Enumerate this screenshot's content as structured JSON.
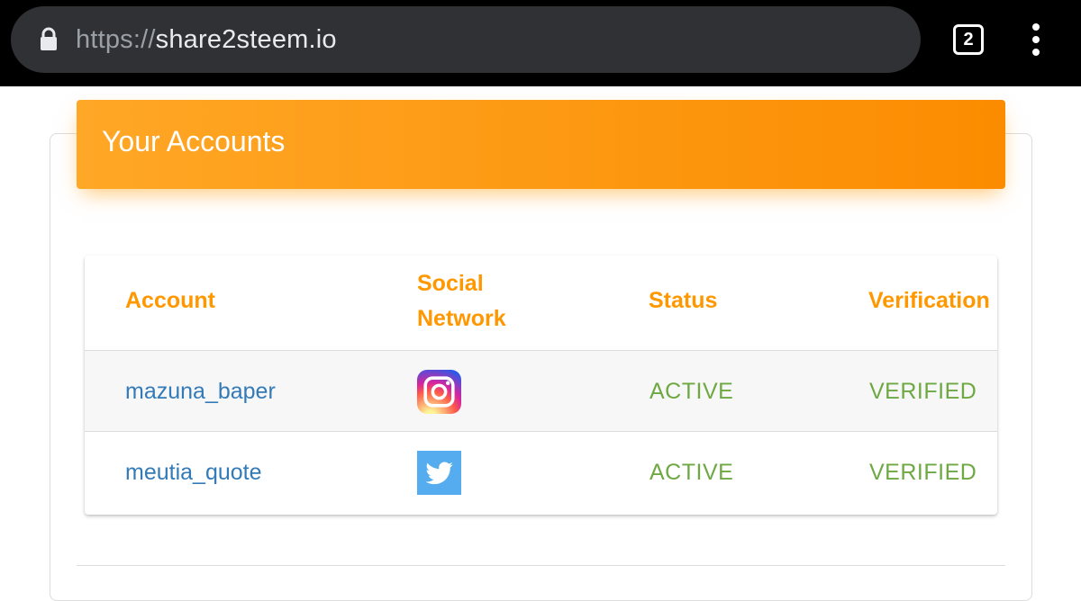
{
  "browser": {
    "url_scheme": "https://",
    "url_host": "share2steem.io",
    "tab_count": "2",
    "lock_icon": "lock-icon",
    "menu_icon": "more-vert-icon"
  },
  "page": {
    "title": "Your Accounts",
    "accent_color": "#ff9800",
    "link_color": "#337ab7",
    "status_color": "#6ea843"
  },
  "table": {
    "headers": {
      "account": "Account",
      "network_line1": "Social",
      "network_line2": "Network",
      "status": "Status",
      "verification": "Verification"
    },
    "rows": [
      {
        "account": "mazuna_baper",
        "network": "instagram-icon",
        "status": "ACTIVE",
        "verification": "VERIFIED"
      },
      {
        "account": "meutia_quote",
        "network": "twitter-icon",
        "status": "ACTIVE",
        "verification": "VERIFIED"
      }
    ]
  }
}
